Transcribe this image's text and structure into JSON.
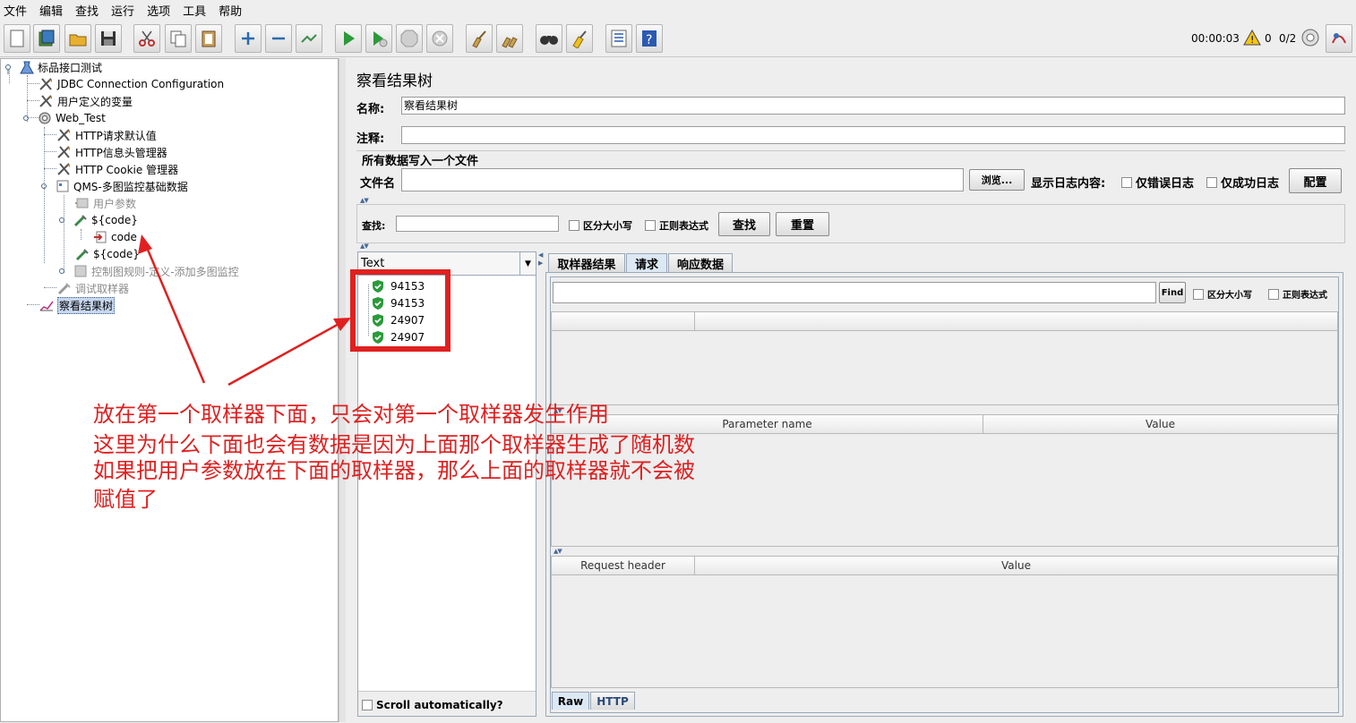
{
  "menu": [
    "文件",
    "编辑",
    "查找",
    "运行",
    "选项",
    "工具",
    "帮助"
  ],
  "toolbar_status": {
    "timer": "00:00:03",
    "warnings": "0",
    "threads": "0/2"
  },
  "tree": {
    "root": "标品接口测试",
    "jdbc": "JDBC Connection Configuration",
    "user_vars": "用户定义的变量",
    "web_test": "Web_Test",
    "http_defaults": "HTTP请求默认值",
    "http_header": "HTTP信息头管理器",
    "http_cookie": "HTTP Cookie 管理器",
    "qms": "QMS-多图监控基础数据",
    "user_params": "用户参数",
    "code_sampler1": "${code}",
    "code_child": "code",
    "code_sampler2": "${code}",
    "control_rule": "控制图规则-定义-添加多图监控",
    "debug_sampler": "调试取样器",
    "view_results": "察看结果树"
  },
  "annotation": {
    "line1": "放在第一个取样器下面，只会对第一个取样器发生作用",
    "line2": "这里为什么下面也会有数据是因为上面那个取样器生成了随机数",
    "line3": "如果把用户参数放在下面的取样器，那么上面的取样器就不会被",
    "line4": "赋值了"
  },
  "panel": {
    "title": "察看结果树",
    "name_label": "名称:",
    "name_value": "察看结果树",
    "comment_label": "注释:",
    "comment_value": "",
    "file_section": "所有数据写入一个文件",
    "file_label": "文件名",
    "file_value": "",
    "browse": "浏览...",
    "log_label": "显示日志内容:",
    "errors_only": "仅错误日志",
    "success_only": "仅成功日志",
    "configure": "配置",
    "search_label": "查找:",
    "search_value": "",
    "case_sensitive": "区分大小写",
    "regex": "正则表达式",
    "find_btn": "查找",
    "reset_btn": "重置"
  },
  "results": {
    "renderer": "Text",
    "items": [
      "94153",
      "94153",
      "24907",
      "24907"
    ],
    "scroll_auto": "Scroll automatically?"
  },
  "tabs": [
    "取样器结果",
    "请求",
    "响应数据"
  ],
  "active_tab": "请求",
  "request": {
    "find": "Find",
    "case_sensitive": "区分大小写",
    "regex": "正则表达式",
    "find_value": "",
    "param_name": "Parameter name",
    "param_value": "Value",
    "req_header": "Request header",
    "req_value": "Value",
    "bottom_tabs": [
      "Raw",
      "HTTP"
    ]
  },
  "colors": {
    "annotation": "#e02020",
    "success": "#2a9a3a",
    "selection": "#c8d8f0"
  }
}
